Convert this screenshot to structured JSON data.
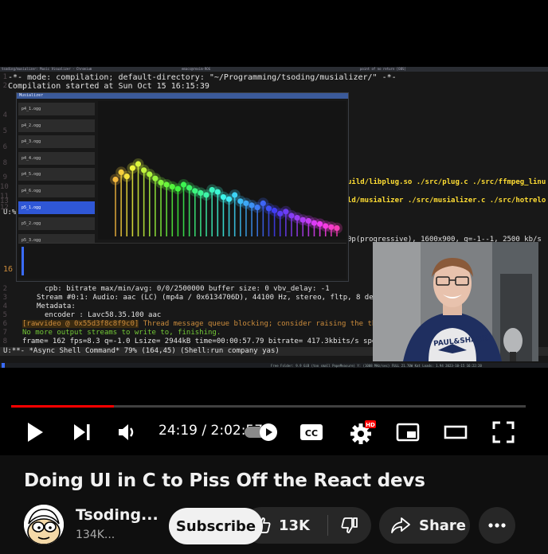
{
  "video": {
    "window_titles": {
      "left": "tsoding/musializer: Music Visualizer - Chromium",
      "middle": "emacs@rexim-ROG",
      "right": "point of no return [OBS]"
    },
    "emacs": {
      "mode_line_1": "-*- mode: compilation; default-directory: \"~/Programming/tsoding/musializer/\" -*-",
      "line_2": "Compilation started at Sun Oct 15 16:15:39",
      "build_line_1": "uild/libplug.so ./src/plug.c ./src/ffmpeg_linu",
      "build_line_2": "ld/musializer ./src/musializer.c ./src/hotrelo",
      "build_line_3": "0p(progressive), 1600x900, q=-1--1, 2500 kb/s",
      "cpb": "cpb: bitrate max/min/avg: 0/0/2500000 buffer size: 0 vbv_delay: -1",
      "stream": "Stream #0:1: Audio: aac (LC) (mp4a / 0x6134706D), 44100 Hz, stereo, fltp, 8 delay 1024,",
      "metadata": "Metadata:",
      "encoder": "encoder         : Lavc58.35.100 aac",
      "warning_prefix": "[rawvideo @ 0x55d3f8c8f9c0]",
      "warning_text": "Thread message queue blocking; consider raising the thread_que",
      "no_more": "No more output streams to write to, finishing.",
      "frame": "frame=  162 fps=8.3 q=-1.0 Lsize=    2944kB time=00:00:57.79 bitrate= 417.3kbits/s speed=",
      "mode_line": "U:**-  *Async Shell Command*   79% (164,45)   (Shell:run company yas)",
      "u_marker": "U:%*",
      "line_16": "16"
    },
    "musializer": {
      "title": "Musializer",
      "playlist": [
        "p4_1.ogg",
        "p4_2.ogg",
        "p4_3.ogg",
        "p4_4.ogg",
        "p4_5.ogg",
        "p4_6.ogg",
        "p5_1.ogg",
        "p5_2.ogg",
        "p5_3.ogg"
      ],
      "active_index": 6
    },
    "status_bar_right": "Free Folder: 9.9 GiB (too small PopeMeasure)  Y: (1008 MHz/sec)  FULL 21.70W  Kat Loads: 1.94  2023-10-15 16:22:20"
  },
  "controls": {
    "time": "24:19 / 2:02:57",
    "progress_fraction": 0.2,
    "autoplay_on": true,
    "cc_label": "CC",
    "hd_badge": "HD"
  },
  "info": {
    "title": "Doing UI in C to Piss Off the React devs",
    "channel_name": "Tsoding...",
    "subscribers": "134K...",
    "subscribe_label": "Subscribe",
    "likes": "13K",
    "share_label": "Share"
  },
  "colors": {
    "brand_red": "#ff0000",
    "background": "#0f0f0f",
    "pill": "#272727",
    "subscribe_bg": "#f1f1f1",
    "emacs_yellow": "#ffdd33",
    "emacs_green": "#73c936",
    "playlist_active": "#2f57d6"
  },
  "chart_data": {
    "type": "bar",
    "values": [
      0.55,
      0.62,
      0.58,
      0.66,
      0.7,
      0.64,
      0.6,
      0.56,
      0.52,
      0.5,
      0.48,
      0.46,
      0.5,
      0.47,
      0.44,
      0.42,
      0.4,
      0.45,
      0.43,
      0.38,
      0.36,
      0.4,
      0.34,
      0.32,
      0.3,
      0.28,
      0.32,
      0.27,
      0.25,
      0.22,
      0.24,
      0.2,
      0.18,
      0.16,
      0.15,
      0.13,
      0.12,
      0.1,
      0.09,
      0.08
    ],
    "ylim": [
      0,
      1
    ]
  }
}
